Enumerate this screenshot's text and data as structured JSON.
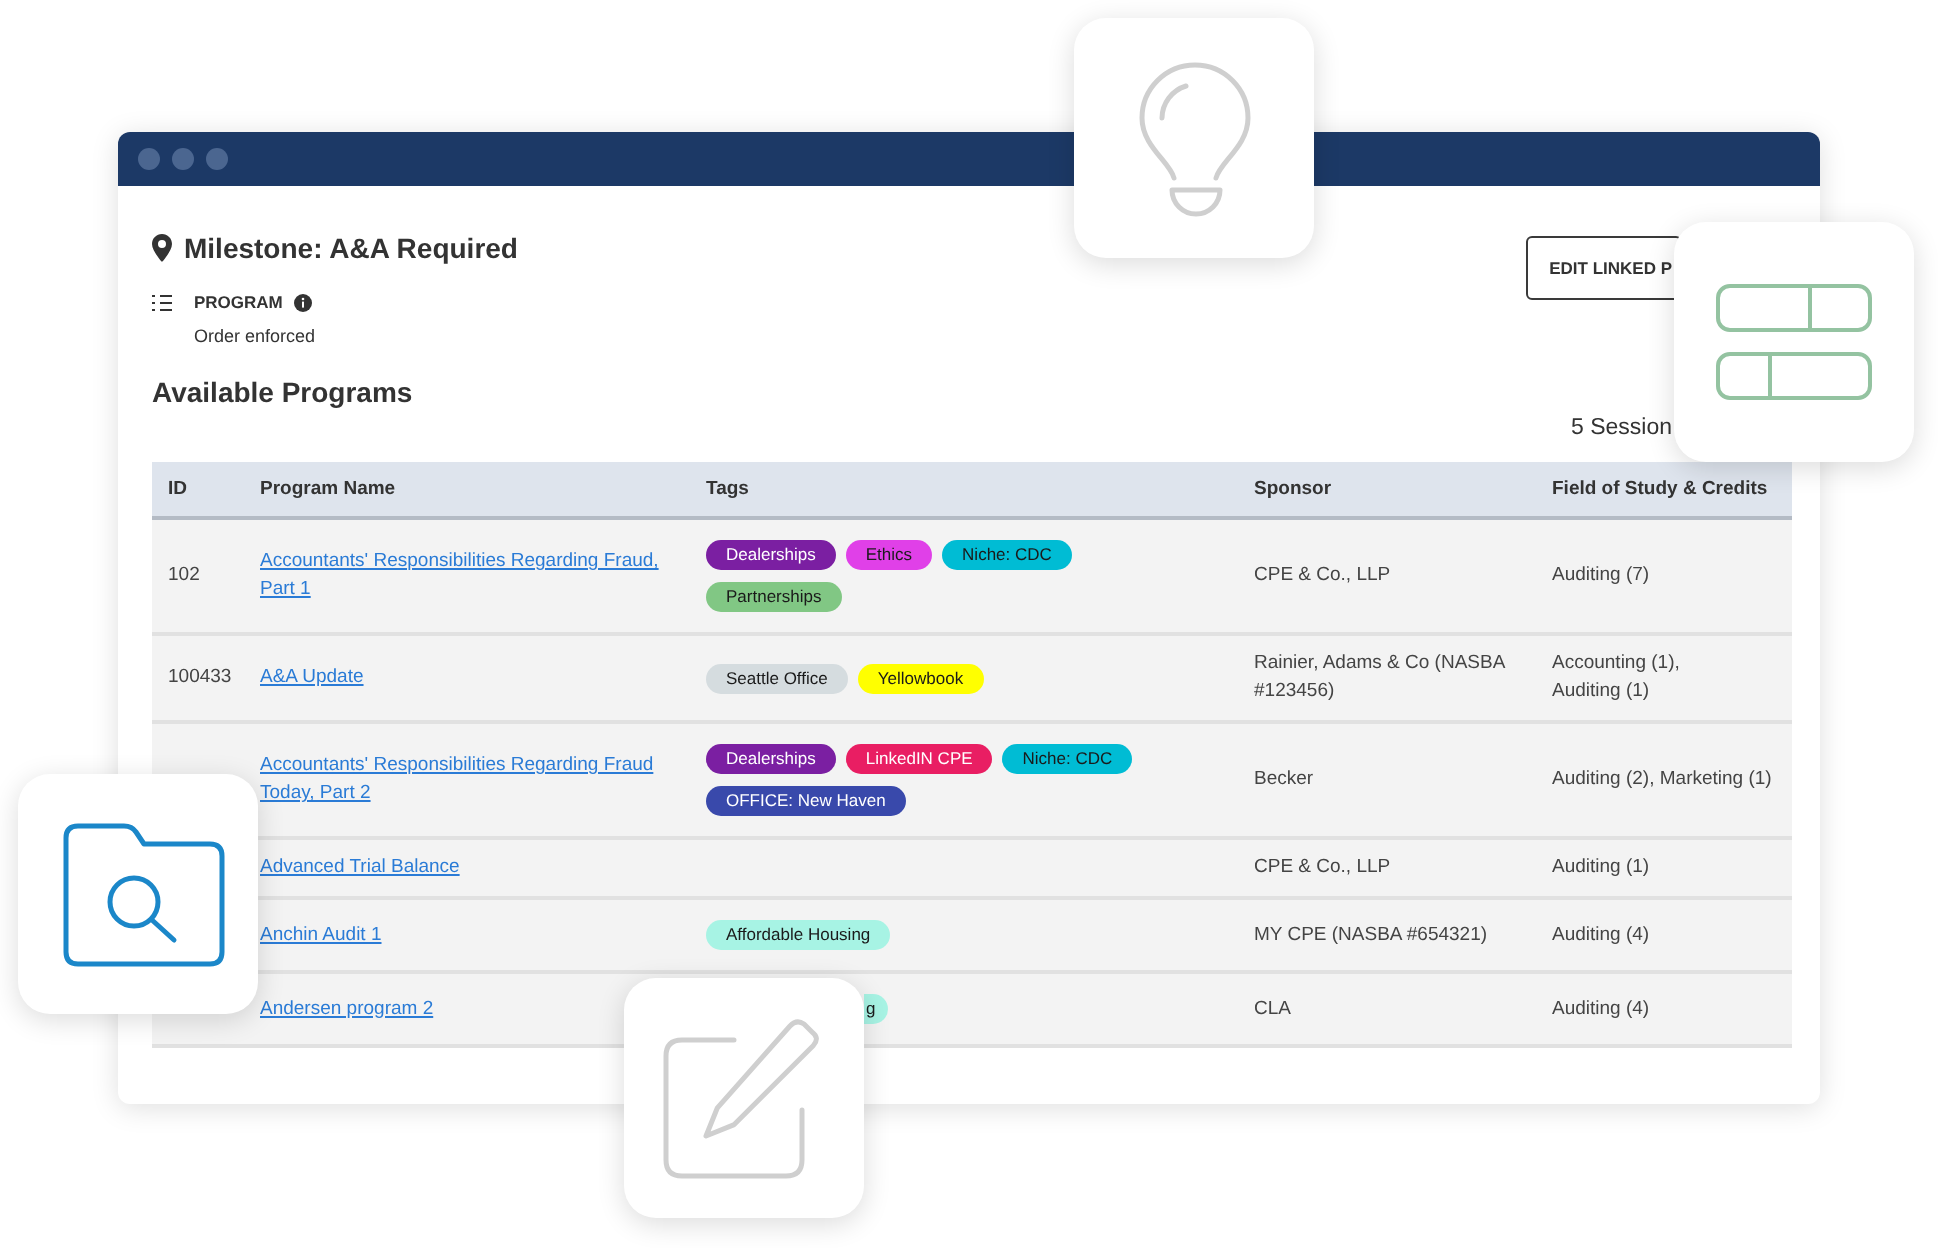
{
  "header": {
    "title": "Milestone: A&A Required",
    "program_label": "PROGRAM",
    "program_note": "Order enforced",
    "edit_button": "EDIT LINKED P"
  },
  "section": {
    "title": "Available Programs",
    "count": "5 Session"
  },
  "table": {
    "columns": [
      "ID",
      "Program Name",
      "Tags",
      "Sponsor",
      "Field of Study & Credits"
    ],
    "rows": [
      {
        "id": "102",
        "name": "Accountants' Responsibilities Regarding Fraud, Part 1",
        "tags": [
          {
            "label": "Dealerships",
            "color": "#7b1fa2",
            "kind": "pill"
          },
          {
            "label": "Ethics",
            "color": "#e040e8",
            "kind": "pill"
          },
          {
            "label": "Niche: CDC",
            "color": "#00bcd4",
            "kind": "pill"
          },
          {
            "label": "Partnerships",
            "color": "#81c784",
            "kind": "pill"
          }
        ],
        "sponsor": "CPE & Co., LLP",
        "credits": [
          "Auditing (7)"
        ]
      },
      {
        "id": "100433",
        "name": "A&A Update",
        "tags": [
          {
            "label": "Seattle Office",
            "color": "#d5dcdf",
            "kind": "pill"
          },
          {
            "label": "Yellowbook",
            "color": "#ffff00",
            "kind": "pill"
          }
        ],
        "sponsor": "Rainier, Adams & Co (NASBA #123456)",
        "credits": [
          "Accounting (1),",
          "Auditing (1)"
        ]
      },
      {
        "name": "Accountants' Responsibilities Regarding Fraud Today, Part 2",
        "tags": [
          {
            "label": "Dealerships",
            "color": "#7b1fa2",
            "kind": "pill"
          },
          {
            "label": "LinkedIN CPE",
            "color": "#e91e63",
            "kind": "pill"
          },
          {
            "label": "Niche: CDC",
            "color": "#00bcd4",
            "kind": "pill"
          },
          {
            "label": "OFFICE: New Haven",
            "color": "#3949ab",
            "kind": "pill"
          }
        ],
        "sponsor": "Becker",
        "credits": [
          "Auditing (2),",
          "Marketing (1)"
        ]
      },
      {
        "name": "Advanced Trial Balance",
        "sponsor": "CPE & Co., LLP",
        "credits": [
          "Auditing (1)"
        ]
      },
      {
        "name": "Anchin Audit 1",
        "tags": [
          {
            "label": "Affordable Housing",
            "color": "#a7f3e4",
            "kind": "pill"
          }
        ],
        "sponsor": "MY CPE (NASBA #654321)",
        "credits": [
          "Auditing (4)"
        ]
      },
      {
        "name": "Andersen program 2",
        "tags": [
          {
            "label": "g",
            "color": "#a7f3e4",
            "kind": "cut"
          }
        ],
        "sponsor": "CLA",
        "credits": [
          "Auditing (4)"
        ]
      }
    ]
  }
}
